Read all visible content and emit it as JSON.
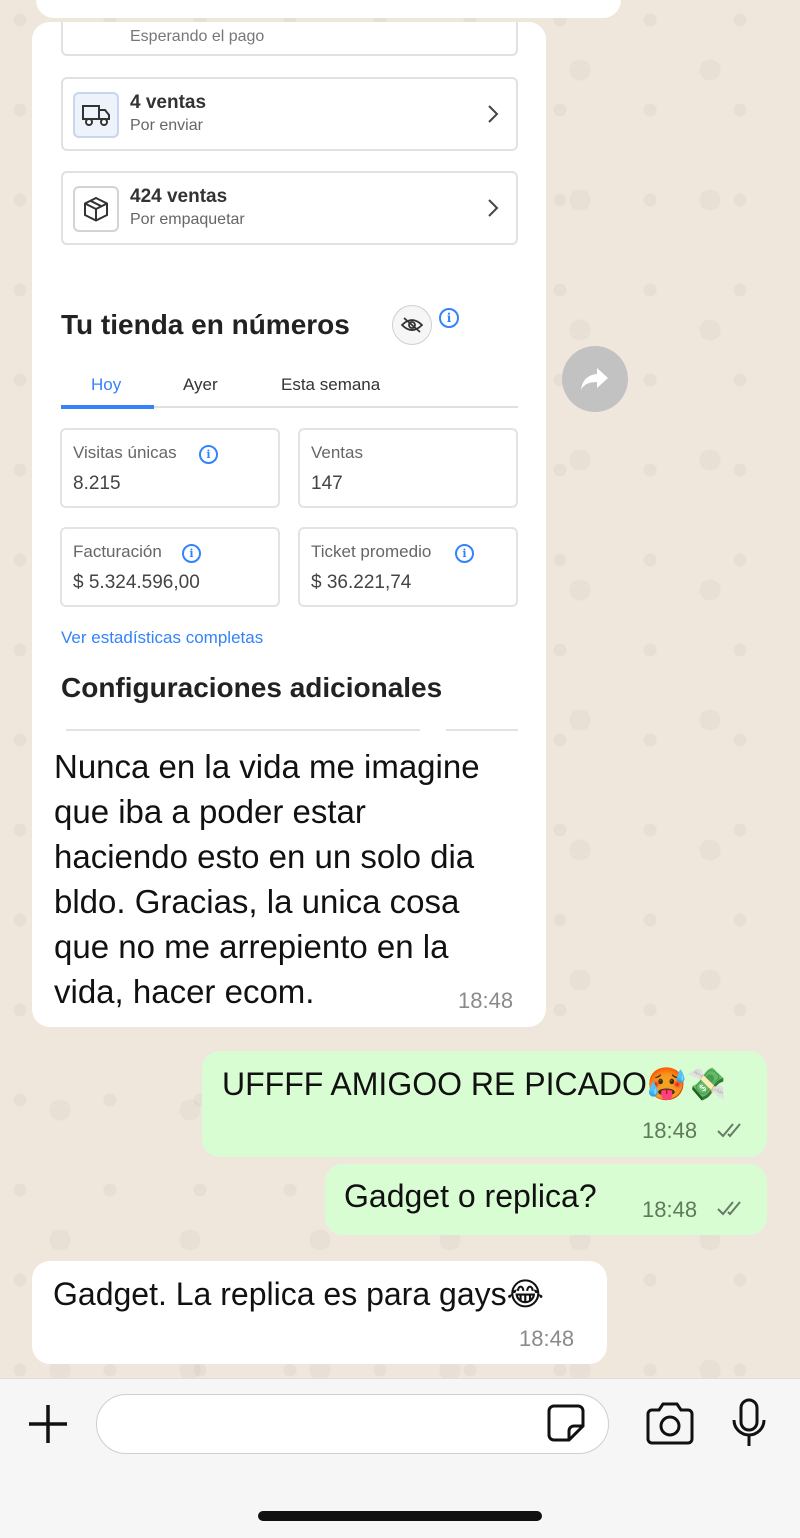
{
  "store_screenshot": {
    "partial_card_label": "Esperando el pago",
    "order_cards": [
      {
        "title": "4 ventas",
        "subtitle": "Por enviar",
        "icon": "truck-icon"
      },
      {
        "title": "424 ventas",
        "subtitle": "Por empaquetar",
        "icon": "box-icon"
      }
    ],
    "stats_title": "Tu tienda en números",
    "tabs": [
      "Hoy",
      "Ayer",
      "Esta semana"
    ],
    "active_tab": "Hoy",
    "stats": [
      {
        "label": "Visitas únicas",
        "value": "8.215",
        "has_info": true
      },
      {
        "label": "Ventas",
        "value": "147",
        "has_info": false
      },
      {
        "label": "Facturación",
        "value": "$ 5.324.596,00",
        "has_info": true
      },
      {
        "label": "Ticket promedio",
        "value": "$ 36.221,74",
        "has_info": true
      }
    ],
    "stats_link": "Ver estadísticas completas",
    "config_title": "Configuraciones adicionales",
    "accent_color": "#3483fa"
  },
  "messages": [
    {
      "direction": "incoming",
      "lines": [
        "Nunca en la vida me imagine",
        "que iba a poder estar",
        "haciendo esto en un solo dia",
        "bldo. Gracias, la unica cosa",
        "que no me arrepiento en la",
        "vida, hacer ecom."
      ],
      "time": "18:48"
    },
    {
      "direction": "outgoing",
      "text": "UFFFF AMIGOO RE PICADO🥵💸",
      "time": "18:48",
      "status": "read"
    },
    {
      "direction": "outgoing",
      "text": "Gadget o replica?",
      "time": "18:48",
      "status": "read"
    },
    {
      "direction": "incoming",
      "text": "Gadget. La replica es para gays😂",
      "time": "18:48"
    }
  ],
  "composer": {
    "placeholder": ""
  },
  "colors": {
    "chat_background": "#efe7dc",
    "incoming_bubble": "#ffffff",
    "outgoing_bubble": "#d9fdd3",
    "read_ticks": "#53bdeb"
  }
}
